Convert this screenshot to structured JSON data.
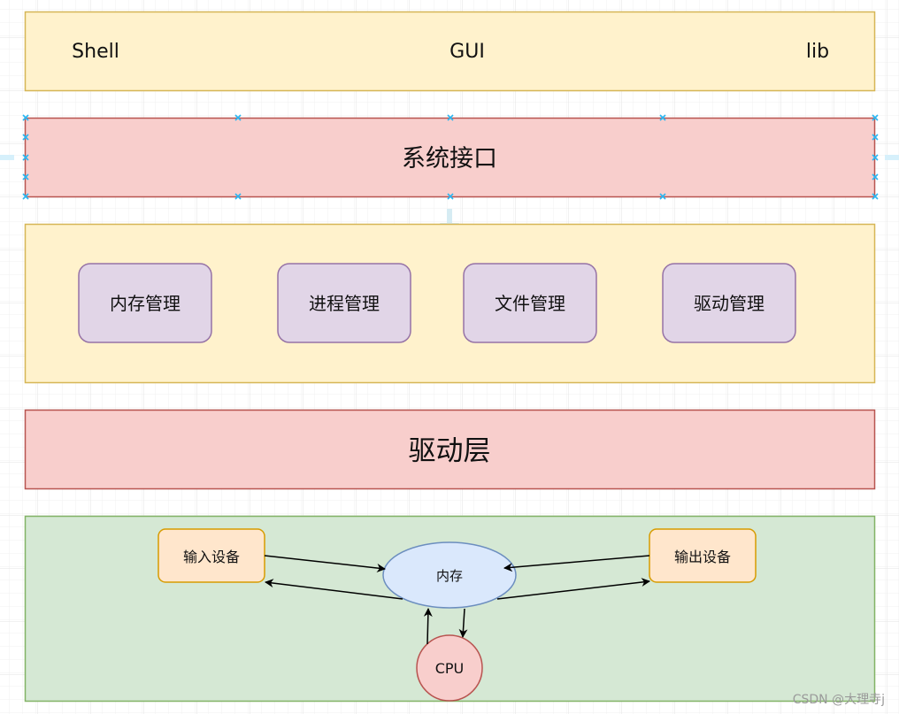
{
  "layers": {
    "apps": {
      "items": [
        "Shell",
        "GUI",
        "lib"
      ]
    },
    "syscall": {
      "label": "系统接口"
    },
    "kernel": {
      "items": [
        "内存管理",
        "进程管理",
        "文件管理",
        "驱动管理"
      ]
    },
    "driver": {
      "label": "驱动层"
    },
    "hardware": {
      "input": "输入设备",
      "output": "输出设备",
      "memory": "内存",
      "cpu": "CPU"
    }
  },
  "watermark": "CSDN @大理寺j",
  "colors": {
    "yellow_fill": "#fff2cc",
    "yellow_stroke": "#d6b656",
    "red_fill": "#f8cecc",
    "red_stroke": "#b85450",
    "purple_fill": "#e1d5e7",
    "purple_stroke": "#9673a6",
    "green_fill": "#d5e8d4",
    "green_stroke": "#82b366",
    "orange_fill": "#ffe6cc",
    "orange_stroke": "#d79b00",
    "blue_fill": "#dae8fc",
    "blue_stroke": "#6c8ebf",
    "selection": "#29b6f2"
  }
}
